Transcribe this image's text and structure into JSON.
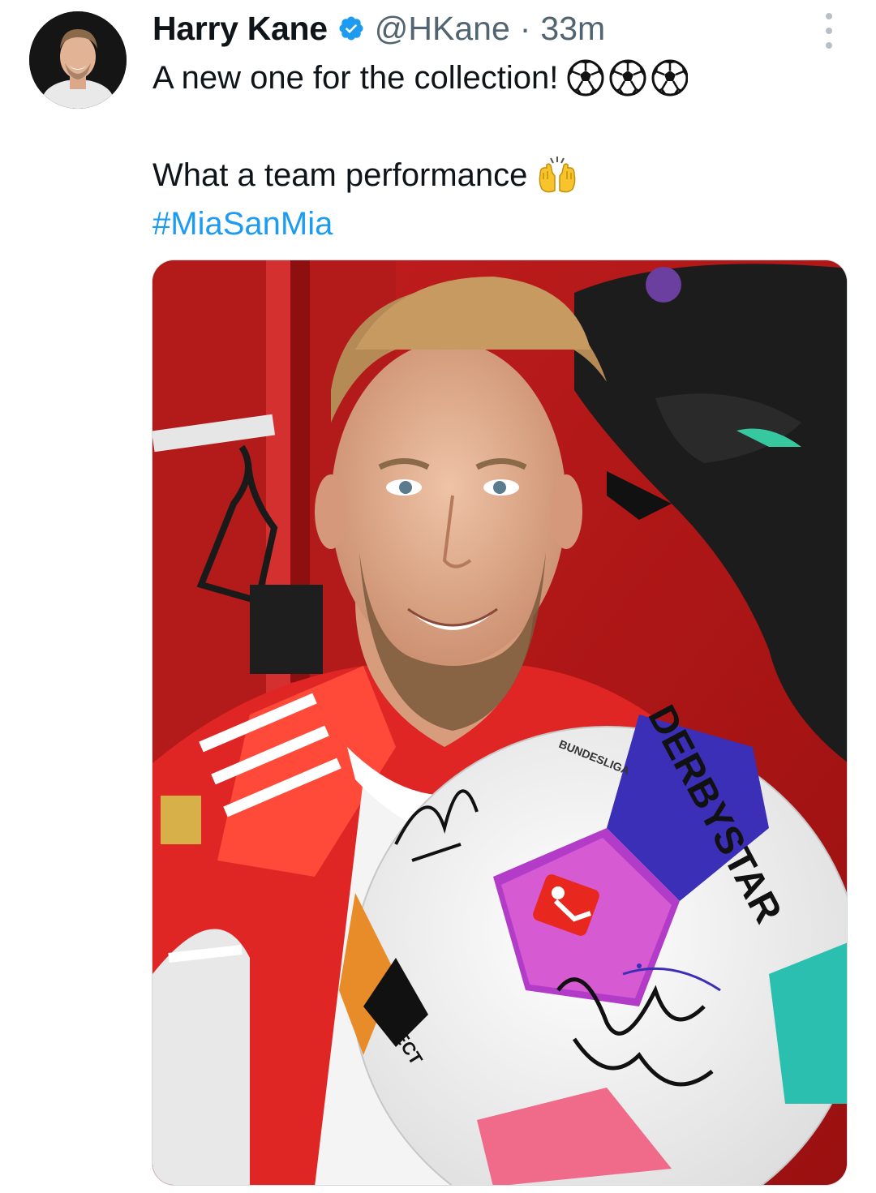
{
  "tweet": {
    "author": {
      "name": "Harry Kane",
      "handle": "@HKane",
      "separator": "·",
      "time": "33m",
      "verified": true
    },
    "text_lines": [
      "A new one for the collection!",
      "What a team performance",
      "#MiaSanMia"
    ],
    "emoji": {
      "line1": "soccer-ball-icon x3",
      "line2": "raised-hands-icon"
    },
    "hashtag": "#MiaSanMia",
    "media": {
      "description_visible_text": [
        "BUNDESLIGA",
        "SELECT",
        "DERBYSTAR"
      ]
    }
  },
  "colors": {
    "text": "#0f1419",
    "secondary": "#536471",
    "link": "#1d9bf0",
    "verified": "#1d9bf0"
  }
}
